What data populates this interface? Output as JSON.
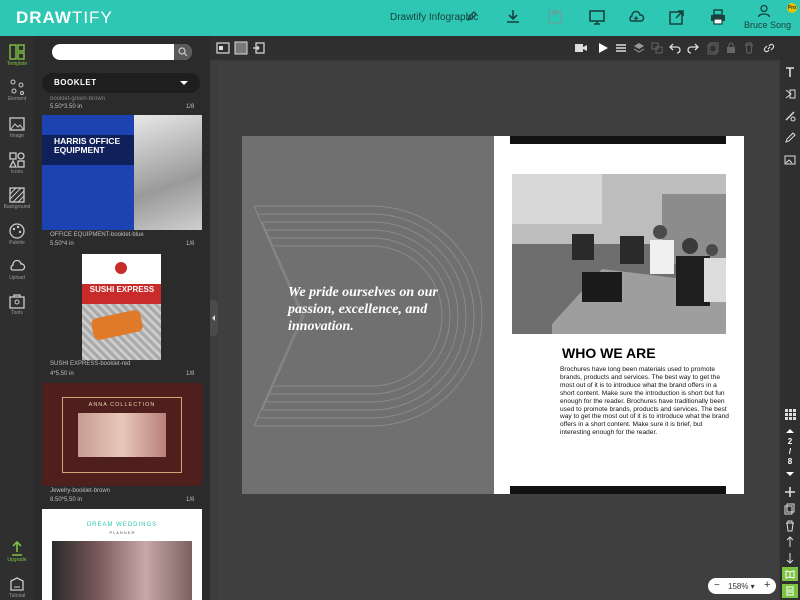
{
  "app": {
    "logo_main": "DRAW",
    "logo_thin": "TIFY",
    "doc_title": "Drawtify Infographic",
    "user_name": "Bruce Song",
    "badge": "Pro"
  },
  "rail": {
    "items": [
      {
        "label": "Template"
      },
      {
        "label": "Element"
      },
      {
        "label": "Image"
      },
      {
        "label": "Icons"
      },
      {
        "label": "Background"
      },
      {
        "label": "Palette"
      },
      {
        "label": "Upload"
      },
      {
        "label": "Tools"
      },
      {
        "label": "Upgrade"
      },
      {
        "label": "Tutorial"
      }
    ]
  },
  "panel": {
    "search_placeholder": "",
    "category": "BOOKLET",
    "templates": [
      {
        "name": "booklet-green-brown",
        "size": "5.50*3.50 in",
        "pages": "1/8"
      },
      {
        "name": "OFFICE EQUIPMENT-booklet-blue",
        "size": "5.50*4 in",
        "pages": "1/8",
        "cover_title": "HARRIS OFFICE EQUIPMENT"
      },
      {
        "name": "SUSHI EXPRESS-booklet-red",
        "size": "4*5.50 in",
        "pages": "1/8",
        "cover_title": "SUSHI EXPRESS"
      },
      {
        "name": "Jewelry-booklet-brown",
        "size": "8.50*5.50 in",
        "pages": "1/8",
        "cover_title": "ANNA COLLECTION"
      },
      {
        "name": "DREAM WEDDINGS",
        "size": "",
        "pages": "",
        "cover_title": "DREAM WEDDINGS",
        "cover_sub": "P L A N N E R"
      }
    ]
  },
  "document": {
    "quote": "We pride ourselves on our passion, excellence, and innovation.",
    "heading": "WHO WE ARE",
    "paragraph": "Brochures have long been materials used to promote brands, products and services. The best way to get the most out of it is to introduce what the brand offers in a short content. Make sure the introduction is short but fun enough for the reader. Brochures have traditionally been used to promote brands, products and services. The best way to get the most out of it is to introduce what the brand offers in a short content. Make sure it is brief, but interesting enough for the reader."
  },
  "pagination": {
    "current": "2",
    "separator": "/",
    "total": "8"
  },
  "zoom": {
    "minus": "−",
    "value": "158% ▾",
    "plus": "+"
  }
}
